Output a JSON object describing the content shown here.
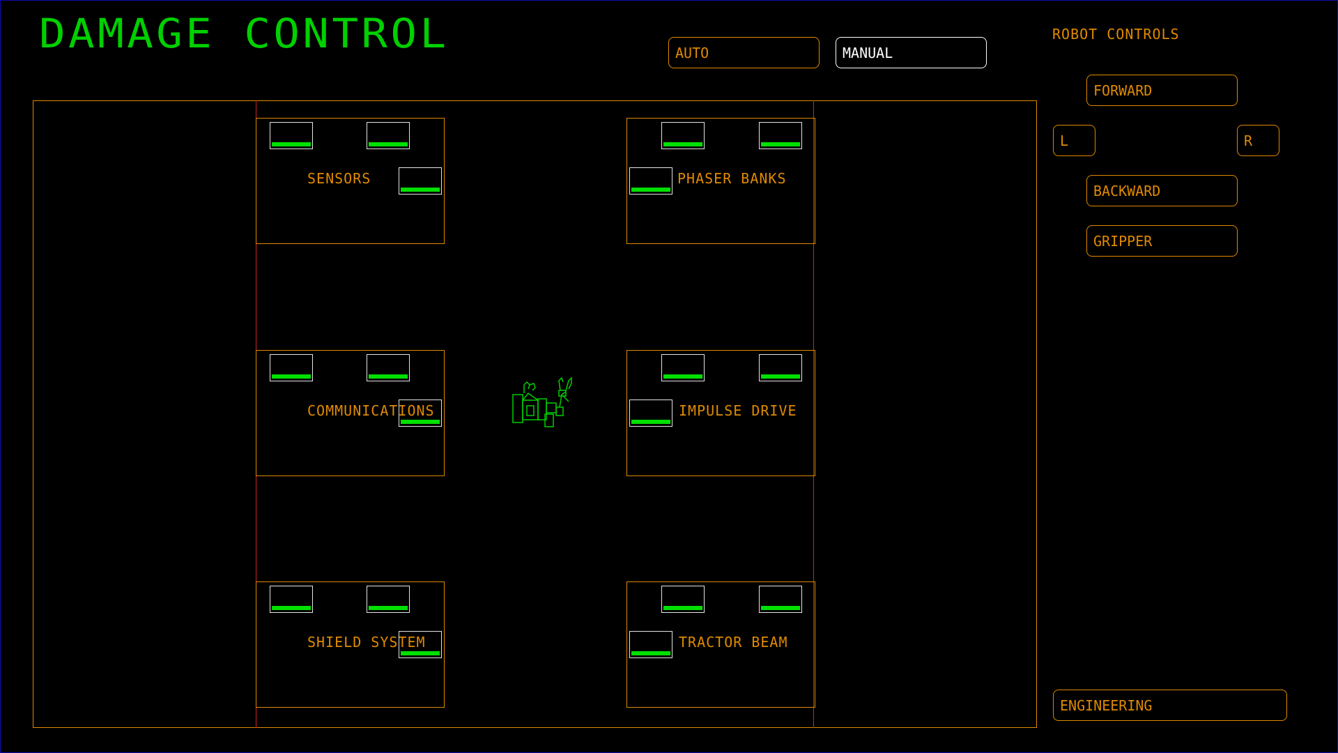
{
  "title": "DAMAGE CONTROL",
  "mode_buttons": {
    "auto": "AUTO",
    "manual": "MANUAL",
    "selected": "MANUAL"
  },
  "robot_controls": {
    "heading": "ROBOT CONTROLS",
    "forward": "FORWARD",
    "left": "L",
    "right": "R",
    "backward": "BACKWARD",
    "gripper": "GRIPPER"
  },
  "footer_button": "ENGINEERING",
  "rooms": [
    {
      "label": "SENSORS"
    },
    {
      "label": "PHASER BANKS"
    },
    {
      "label": "COMMUNICATIONS"
    },
    {
      "label": "IMPULSE DRIVE"
    },
    {
      "label": "SHIELD SYSTEM"
    },
    {
      "label": "TRACTOR BEAM"
    }
  ],
  "colors": {
    "title": "#00d000",
    "accent": "#e08a00",
    "component_health": "#00e000",
    "divider": "#d42020",
    "selected_outline": "#ffffff"
  },
  "icons": {
    "robot": "robot-arm-icon"
  }
}
